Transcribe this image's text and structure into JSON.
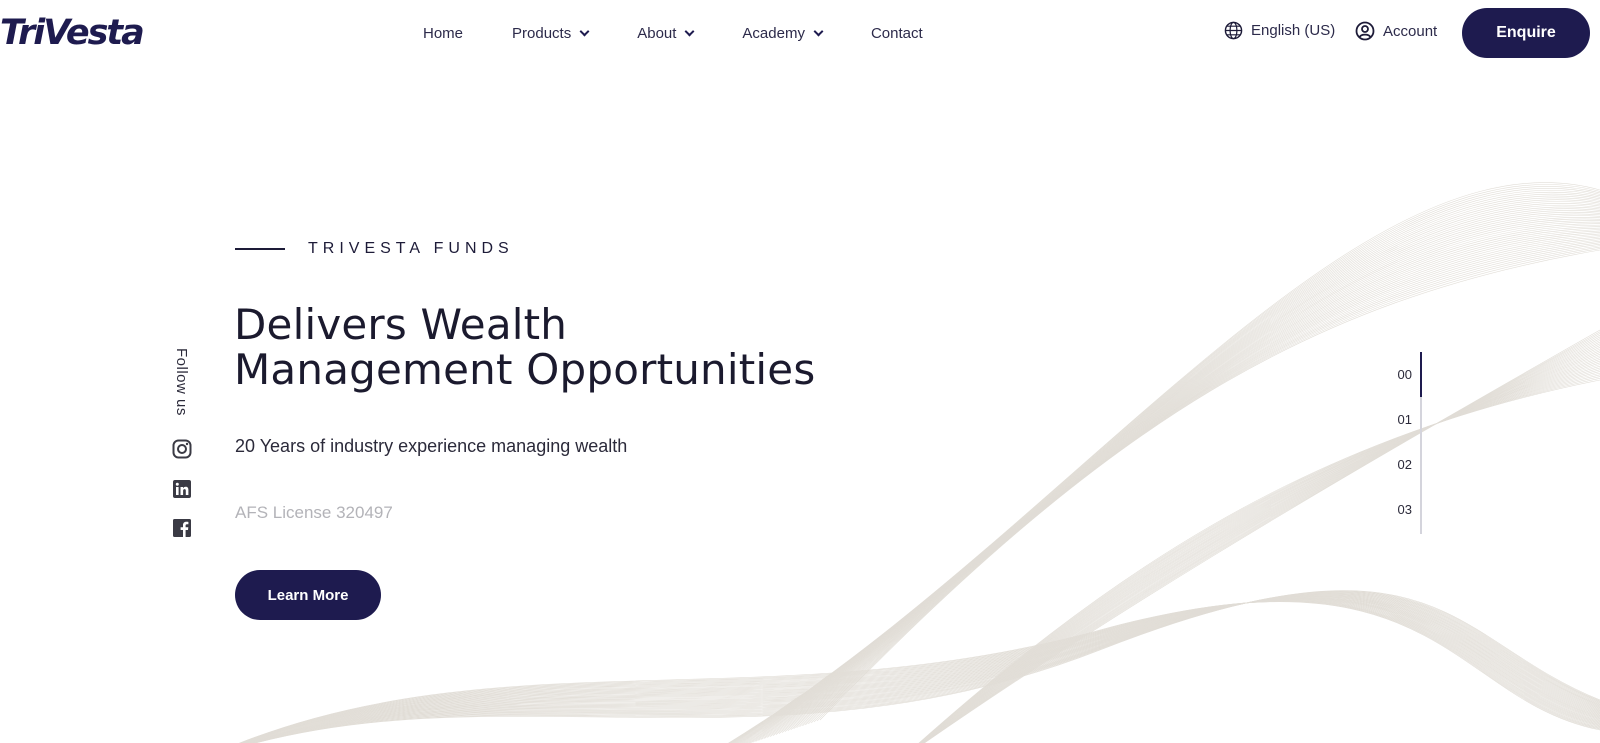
{
  "brand": {
    "logo_text": "TriVesta",
    "accent": "#1e1b4f"
  },
  "nav": {
    "items": [
      {
        "label": "Home",
        "dropdown": false
      },
      {
        "label": "Products",
        "dropdown": true
      },
      {
        "label": "About",
        "dropdown": true
      },
      {
        "label": "Academy",
        "dropdown": true
      },
      {
        "label": "Contact",
        "dropdown": false
      }
    ]
  },
  "header": {
    "language": "English (US)",
    "account": "Account",
    "enquire": "Enquire",
    "icons": {
      "language": "globe-icon",
      "account": "user-circle-icon"
    }
  },
  "hero": {
    "eyebrow": "TRIVESTA FUNDS",
    "title_line1": "Delivers Wealth",
    "title_line2": "Management Opportunities",
    "subtitle": "20 Years of industry experience managing wealth",
    "license": "AFS License 320497",
    "cta": "Learn More"
  },
  "social": {
    "label": "Follow us",
    "icons": [
      "instagram-icon",
      "linkedin-icon",
      "facebook-icon"
    ]
  },
  "slides": {
    "items": [
      "00",
      "01",
      "02",
      "03"
    ],
    "active_index": 0
  }
}
